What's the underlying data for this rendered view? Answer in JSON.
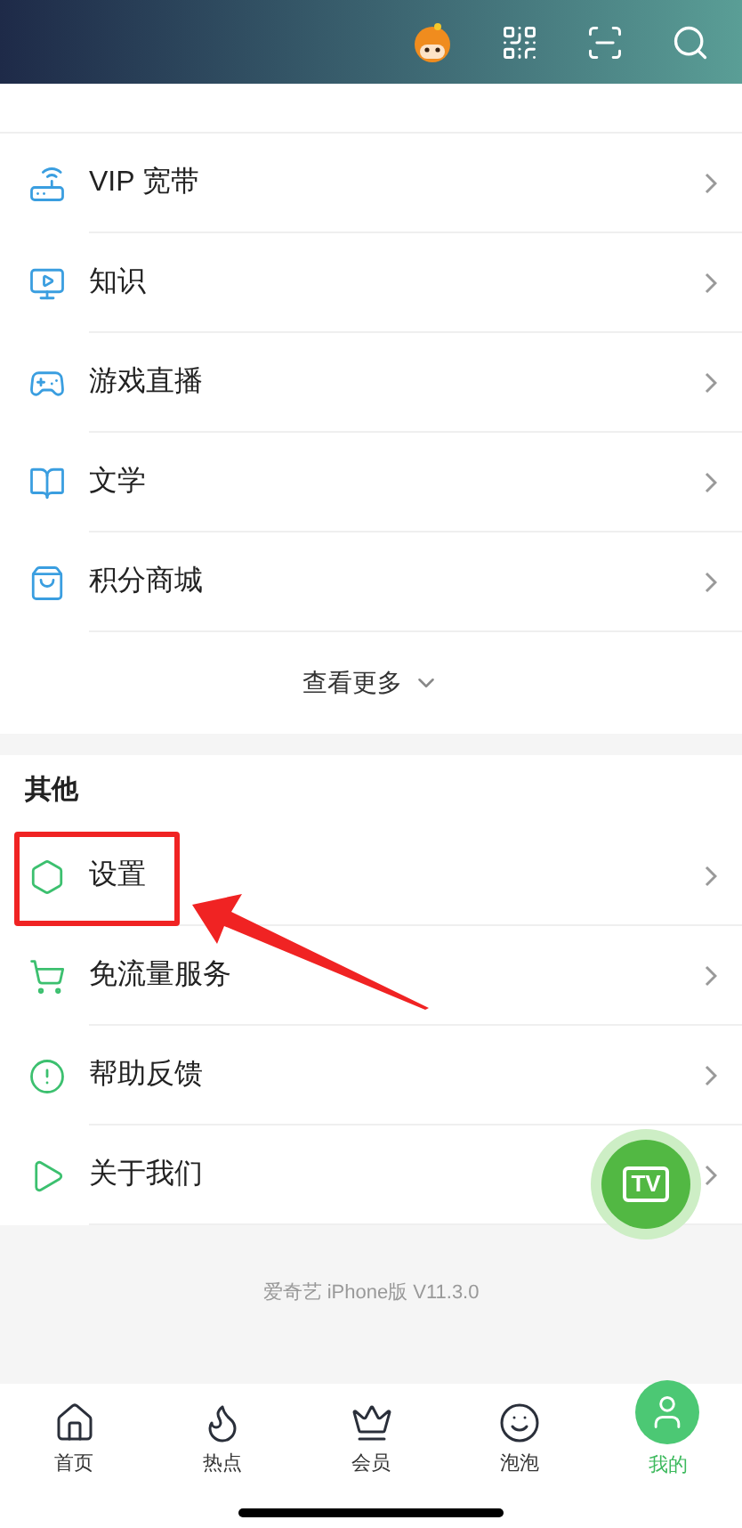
{
  "sections": [
    {
      "items": [
        {
          "label": "VIP 宽带",
          "highlighted": false
        },
        {
          "label": "知识",
          "highlighted": false
        },
        {
          "label": "游戏直播",
          "highlighted": false
        },
        {
          "label": "文学",
          "highlighted": false
        },
        {
          "label": "积分商城",
          "highlighted": false
        }
      ],
      "more": "查看更多"
    },
    {
      "title": "其他",
      "items": [
        {
          "label": "设置",
          "highlighted": true
        },
        {
          "label": "免流量服务",
          "highlighted": false
        },
        {
          "label": "帮助反馈",
          "highlighted": false
        },
        {
          "label": "关于我们",
          "highlighted": false
        }
      ]
    }
  ],
  "version": "爱奇艺 iPhone版 V11.3.0",
  "floating_button": {
    "label": "TV"
  },
  "tabs": [
    {
      "label": "首页",
      "selected": false
    },
    {
      "label": "热点",
      "selected": false
    },
    {
      "label": "会员",
      "selected": false
    },
    {
      "label": "泡泡",
      "selected": false
    },
    {
      "label": "我的",
      "selected": true
    }
  ]
}
